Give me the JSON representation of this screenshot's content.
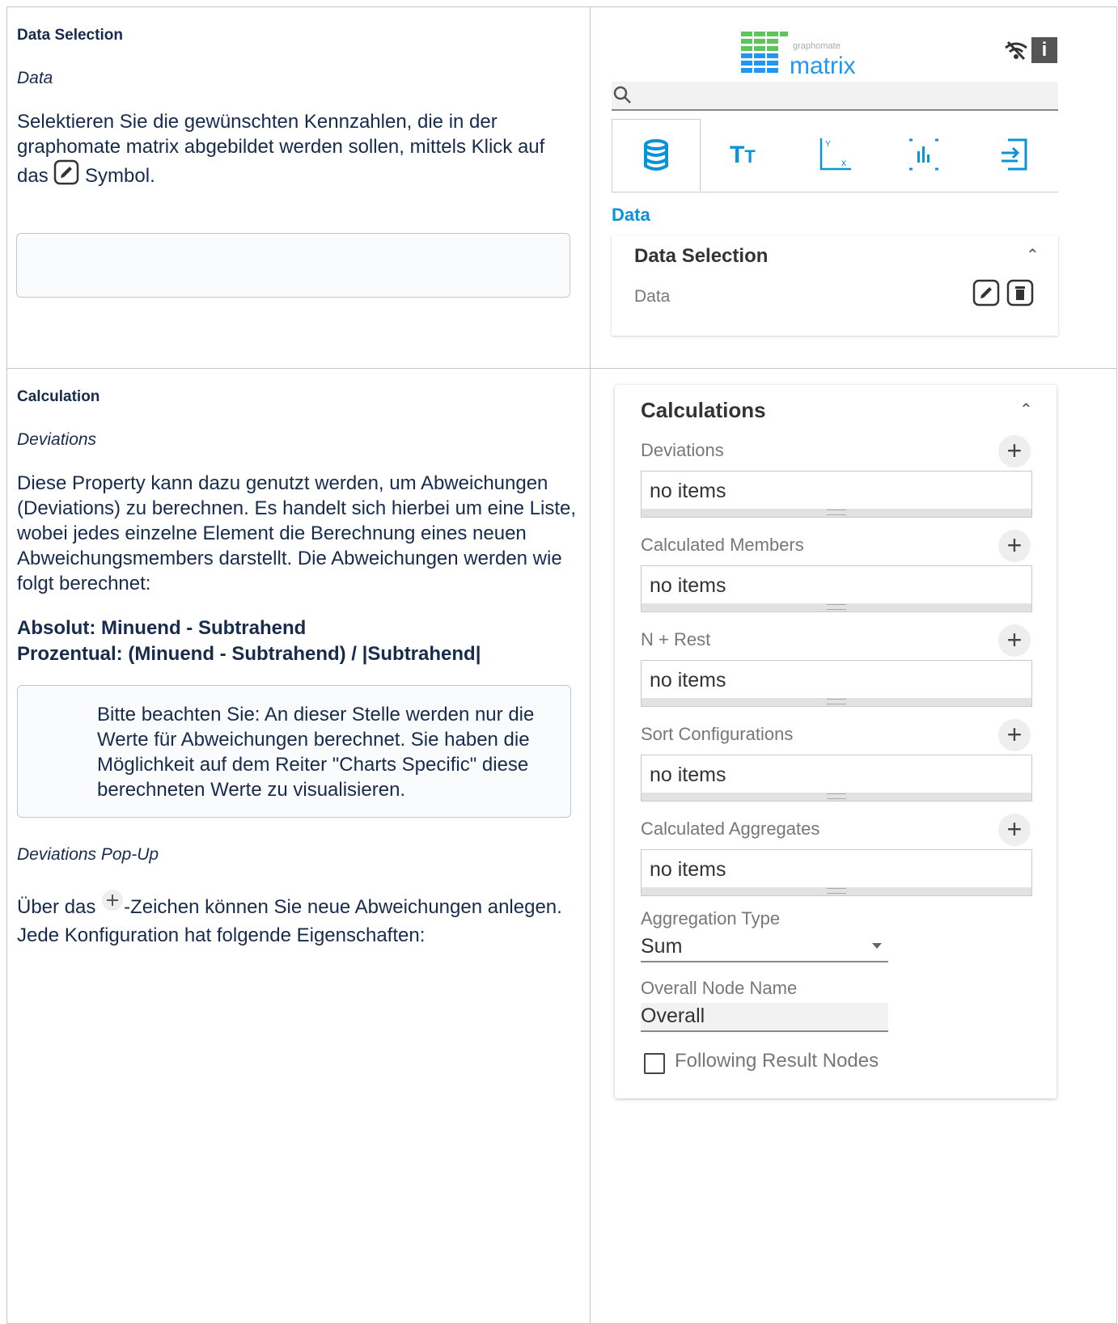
{
  "data_section": {
    "title": "Data Selection",
    "subtitle": "Data",
    "text_before_icon": "Selektieren Sie die gewünschten Kennzahlen, die in der graphomate matrix abgebildet werden sollen, mittels Klick auf das",
    "text_after_icon": "Symbol."
  },
  "calc_section": {
    "title": "Calculation",
    "subtitle": "Deviations",
    "text": "Diese Property kann dazu genutzt werden, um Abweichungen (Deviations) zu berechnen. Es handelt sich hierbei um eine Liste, wobei jedes einzelne Element die Berechnung eines neuen Abweichungsmembers darstellt. Die Abweichungen werden wie folgt berechnet:",
    "formula_absolute": "Absolut: Minuend - Subtrahend",
    "formula_percent": "Prozentual: (Minuend - Subtrahend) / |Subtrahend|",
    "note": "Bitte beachten Sie: An dieser Stelle werden nur die Werte für Abweichungen berechnet. Sie haben die Möglichkeit auf dem Reiter \"Charts Specific\" diese berechneten Werte zu visualisieren.",
    "popup_subtitle": "Deviations Pop-Up",
    "popup_text_before_icon": "Über das",
    "popup_text_after_icon": "-Zeichen können Sie neue Abweichungen anlegen. Jede Konfiguration hat folgende Eigenschaften:"
  },
  "props_panel": {
    "logo_small": "graphomate",
    "logo_big": "matrix",
    "tabs": [
      "database-icon",
      "text-icon",
      "axis-icon",
      "chart-icon",
      "import-icon"
    ],
    "section_label": "Data",
    "card_title": "Data Selection",
    "card_row_label": "Data"
  },
  "calc_panel": {
    "title": "Calculations",
    "lists": [
      {
        "label": "Deviations",
        "value": "no items"
      },
      {
        "label": "Calculated Members",
        "value": "no items"
      },
      {
        "label": "N + Rest",
        "value": "no items"
      },
      {
        "label": "Sort Configurations",
        "value": "no items"
      },
      {
        "label": "Calculated Aggregates",
        "value": "no items"
      }
    ],
    "aggregation_label": "Aggregation Type",
    "aggregation_value": "Sum",
    "overall_label": "Overall Node Name",
    "overall_value": "Overall",
    "checkbox_label": "Following Result Nodes"
  },
  "colors": {
    "accent": "#0a93d6",
    "logo_green": "#5fc35f",
    "logo_blue": "#2196f3"
  }
}
